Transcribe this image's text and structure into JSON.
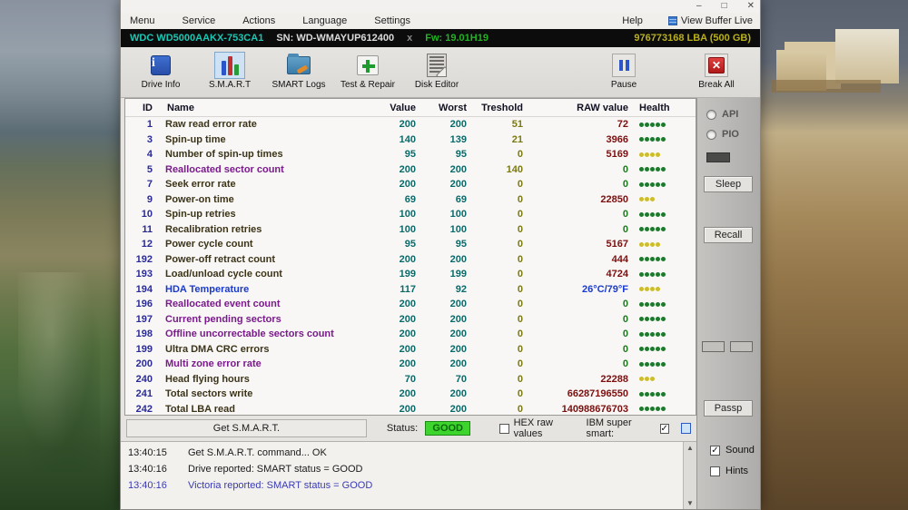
{
  "window": {
    "controls": {
      "minimize": "–",
      "maximize": "□",
      "close": "✕"
    },
    "menu": [
      "Menu",
      "Service",
      "Actions",
      "Language",
      "Settings"
    ],
    "help_label": "Help",
    "view_buffer_label": "View Buffer Live"
  },
  "drive_bar": {
    "model": "WDC WD5000AAKX-753CA1",
    "serial": "SN: WD-WMAYUP612400",
    "x_mark": "x",
    "firmware": "Fw: 19.01H19",
    "capacity": "976773168 LBA (500 GB)"
  },
  "toolbar": {
    "buttons": [
      {
        "label": "Drive Info",
        "icon": "drive-info-icon",
        "active": false
      },
      {
        "label": "S.M.A.R.T",
        "icon": "smart-icon",
        "active": true
      },
      {
        "label": "SMART Logs",
        "icon": "smart-logs-icon",
        "active": false
      },
      {
        "label": "Test & Repair",
        "icon": "test-repair-icon",
        "active": false
      },
      {
        "label": "Disk Editor",
        "icon": "disk-editor-icon",
        "active": false
      }
    ],
    "pause_label": "Pause",
    "break_all_label": "Break All"
  },
  "table": {
    "headers": {
      "id": "ID",
      "name": "Name",
      "value": "Value",
      "worst": "Worst",
      "threshold": "Treshold",
      "raw": "RAW value",
      "health": "Health"
    },
    "rows": [
      {
        "id": "1",
        "name": "Raw read error rate",
        "name_style": "default",
        "value": "200",
        "worst": "200",
        "threshold": "51",
        "raw": "72",
        "raw_style": "num",
        "dots": 5,
        "dot_color": "green"
      },
      {
        "id": "3",
        "name": "Spin-up time",
        "name_style": "default",
        "value": "140",
        "worst": "139",
        "threshold": "21",
        "raw": "3966",
        "raw_style": "num",
        "dots": 5,
        "dot_color": "green"
      },
      {
        "id": "4",
        "name": "Number of spin-up times",
        "name_style": "default",
        "value": "95",
        "worst": "95",
        "threshold": "0",
        "raw": "5169",
        "raw_style": "num",
        "dots": 4,
        "dot_color": "yellow"
      },
      {
        "id": "5",
        "name": "Reallocated sector count",
        "name_style": "purple",
        "value": "200",
        "worst": "200",
        "threshold": "140",
        "raw": "0",
        "raw_style": "zero",
        "dots": 5,
        "dot_color": "green"
      },
      {
        "id": "7",
        "name": "Seek error rate",
        "name_style": "default",
        "value": "200",
        "worst": "200",
        "threshold": "0",
        "raw": "0",
        "raw_style": "zero",
        "dots": 5,
        "dot_color": "green"
      },
      {
        "id": "9",
        "name": "Power-on time",
        "name_style": "default",
        "value": "69",
        "worst": "69",
        "threshold": "0",
        "raw": "22850",
        "raw_style": "num",
        "dots": 3,
        "dot_color": "yellow"
      },
      {
        "id": "10",
        "name": "Spin-up retries",
        "name_style": "default",
        "value": "100",
        "worst": "100",
        "threshold": "0",
        "raw": "0",
        "raw_style": "zero",
        "dots": 5,
        "dot_color": "green"
      },
      {
        "id": "11",
        "name": "Recalibration retries",
        "name_style": "default",
        "value": "100",
        "worst": "100",
        "threshold": "0",
        "raw": "0",
        "raw_style": "zero",
        "dots": 5,
        "dot_color": "green"
      },
      {
        "id": "12",
        "name": "Power cycle count",
        "name_style": "default",
        "value": "95",
        "worst": "95",
        "threshold": "0",
        "raw": "5167",
        "raw_style": "num",
        "dots": 4,
        "dot_color": "yellow"
      },
      {
        "id": "192",
        "name": "Power-off retract count",
        "name_style": "default",
        "value": "200",
        "worst": "200",
        "threshold": "0",
        "raw": "444",
        "raw_style": "num",
        "dots": 5,
        "dot_color": "green"
      },
      {
        "id": "193",
        "name": "Load/unload cycle count",
        "name_style": "default",
        "value": "199",
        "worst": "199",
        "threshold": "0",
        "raw": "4724",
        "raw_style": "num",
        "dots": 5,
        "dot_color": "green"
      },
      {
        "id": "194",
        "name": "HDA Temperature",
        "name_style": "blue",
        "value": "117",
        "worst": "92",
        "threshold": "0",
        "raw": "26°C/79°F",
        "raw_style": "temp",
        "dots": 4,
        "dot_color": "yellow"
      },
      {
        "id": "196",
        "name": "Reallocated event count",
        "name_style": "purple",
        "value": "200",
        "worst": "200",
        "threshold": "0",
        "raw": "0",
        "raw_style": "zero",
        "dots": 5,
        "dot_color": "green"
      },
      {
        "id": "197",
        "name": "Current pending sectors",
        "name_style": "purple",
        "value": "200",
        "worst": "200",
        "threshold": "0",
        "raw": "0",
        "raw_style": "zero",
        "dots": 5,
        "dot_color": "green"
      },
      {
        "id": "198",
        "name": "Offline uncorrectable sectors count",
        "name_style": "purple",
        "value": "200",
        "worst": "200",
        "threshold": "0",
        "raw": "0",
        "raw_style": "zero",
        "dots": 5,
        "dot_color": "green"
      },
      {
        "id": "199",
        "name": "Ultra DMA CRC errors",
        "name_style": "default",
        "value": "200",
        "worst": "200",
        "threshold": "0",
        "raw": "0",
        "raw_style": "zero",
        "dots": 5,
        "dot_color": "green"
      },
      {
        "id": "200",
        "name": "Multi zone error rate",
        "name_style": "purple",
        "value": "200",
        "worst": "200",
        "threshold": "0",
        "raw": "0",
        "raw_style": "zero",
        "dots": 5,
        "dot_color": "green"
      },
      {
        "id": "240",
        "name": "Head flying hours",
        "name_style": "default",
        "value": "70",
        "worst": "70",
        "threshold": "0",
        "raw": "22288",
        "raw_style": "num",
        "dots": 3,
        "dot_color": "yellow"
      },
      {
        "id": "241",
        "name": "Total sectors write",
        "name_style": "default",
        "value": "200",
        "worst": "200",
        "threshold": "0",
        "raw": "66287196550",
        "raw_style": "num",
        "dots": 5,
        "dot_color": "green"
      },
      {
        "id": "242",
        "name": "Total LBA read",
        "name_style": "default",
        "value": "200",
        "worst": "200",
        "threshold": "0",
        "raw": "140988676703",
        "raw_style": "num",
        "dots": 5,
        "dot_color": "green"
      }
    ]
  },
  "status_bar": {
    "get_smart_label": "Get S.M.A.R.T.",
    "status_label": "Status:",
    "status_value": "GOOD",
    "status_colors": {
      "bg": "#3ed42e",
      "text": "#0a6a0a"
    },
    "hex_label": "HEX raw values",
    "hex_checked": false,
    "ibm_label": "IBM super smart:",
    "ibm_checked": true
  },
  "log": {
    "lines": [
      {
        "time": "13:40:15",
        "text": "Get S.M.A.R.T. command... OK",
        "highlight": false
      },
      {
        "time": "13:40:16",
        "text": "Drive reported: SMART status = GOOD",
        "highlight": false
      },
      {
        "time": "13:40:16",
        "text": "Victoria reported: SMART status = GOOD",
        "highlight": true
      }
    ],
    "scroll_up": "▲",
    "scroll_down": "▼"
  },
  "right_panel": {
    "api_label": "API",
    "pio_label": "PIO",
    "sleep_label": "Sleep",
    "recall_label": "Recall",
    "passp_label": "Passp",
    "sound_label": "Sound",
    "sound_checked": true,
    "hints_label": "Hints",
    "hints_checked": false
  },
  "icons": {
    "checkmark": "✓"
  },
  "colors": {
    "health_green": "#1d7a2d",
    "health_yellow": "#cdbd2a",
    "accent_blue": "#2a55c8"
  }
}
